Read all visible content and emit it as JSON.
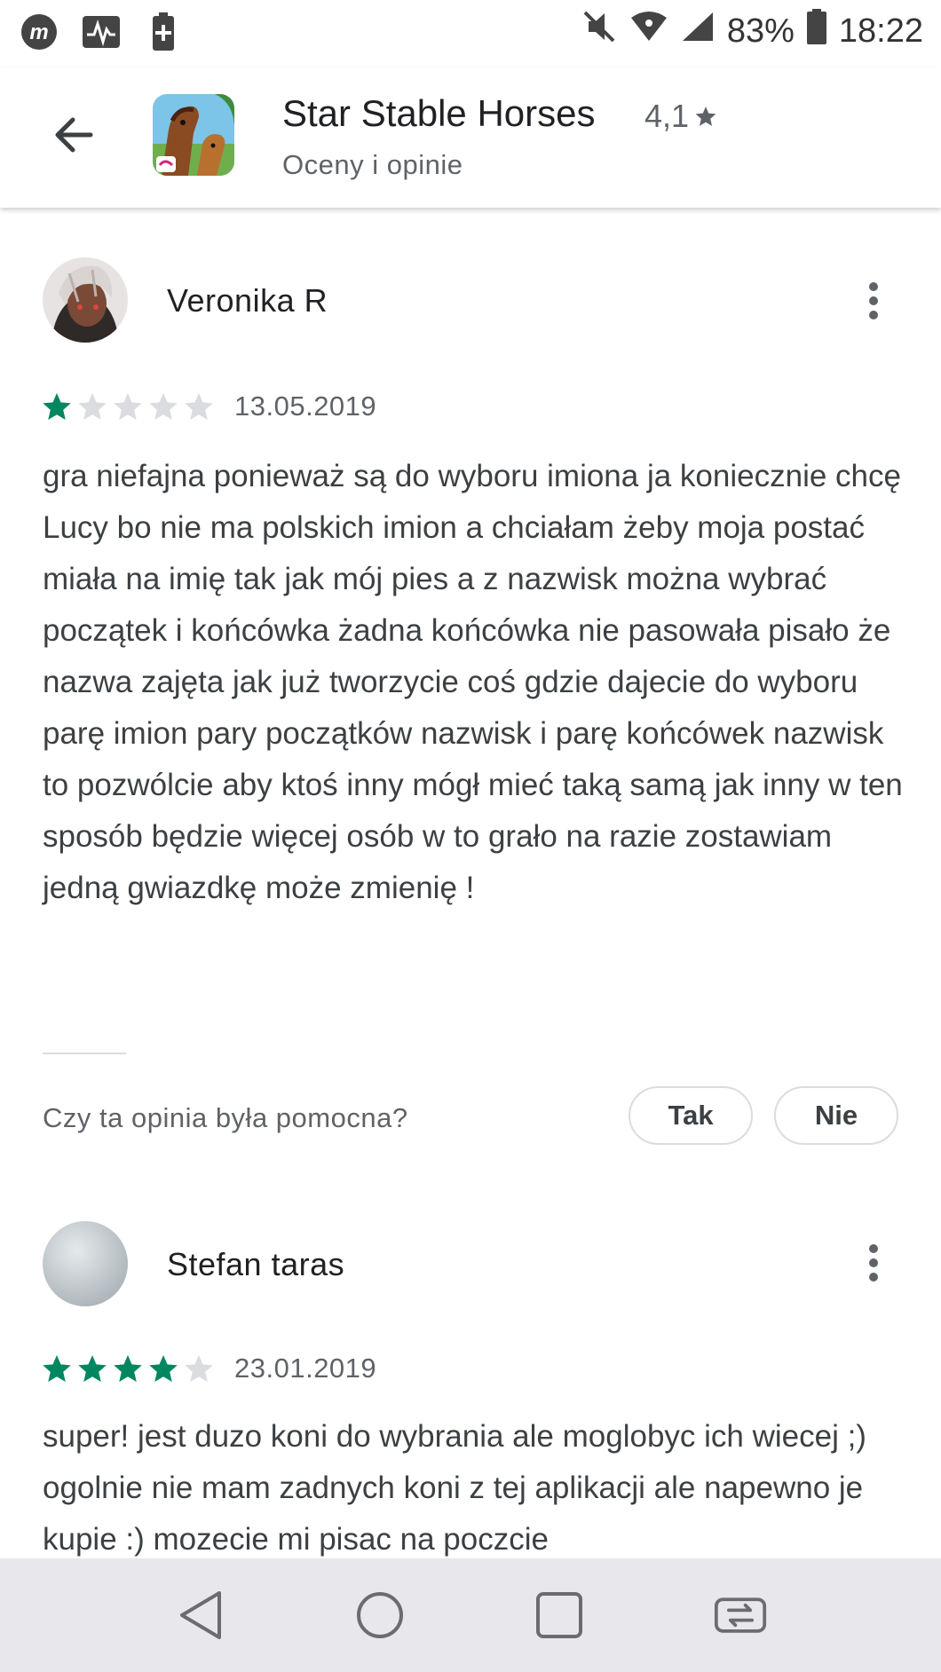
{
  "status_bar": {
    "battery": "83%",
    "time": "18:22",
    "icons": [
      "m-app-icon",
      "activity-icon",
      "battery-saver-icon",
      "mute-icon",
      "wifi-icon",
      "signal-icon",
      "battery-icon"
    ]
  },
  "header": {
    "app_name": "Star Stable Horses",
    "rating": "4,1",
    "subtitle": "Oceny i opinie"
  },
  "reviews": [
    {
      "author": "Veronika R",
      "stars": 1,
      "date": "13.05.2019",
      "text": "gra niefajna ponieważ są do wyboru imiona ja koniecznie chcę Lucy bo nie ma polskich imion a chciałam żeby moja postać miała na imię tak jak mój pies a z nazwisk można wybrać początek i końcówka żadna końcówka nie pasowała pisało że nazwa zajęta jak już tworzycie coś gdzie dajecie do wyboru parę imion pary początków nazwisk i parę końcówek nazwisk to pozwólcie aby ktoś inny mógł mieć taką samą jak inny w ten sposób będzie więcej osób w to grało na razie zostawiam jedną gwiazdkę może zmienię !",
      "helpful_question": "Czy ta opinia była pomocna?",
      "yes_label": "Tak",
      "no_label": "Nie"
    },
    {
      "author": "Stefan taras",
      "stars": 4,
      "date": "23.01.2019",
      "text": "super! jest duzo koni do wybrania ale moglobyc ich wiecej ;) ogolnie nie mam zadnych koni z tej aplikacji ale napewno je kupie :) mozecie mi pisac na poczcie"
    }
  ],
  "colors": {
    "star_filled": "#01875f",
    "star_empty": "#dadce0"
  }
}
